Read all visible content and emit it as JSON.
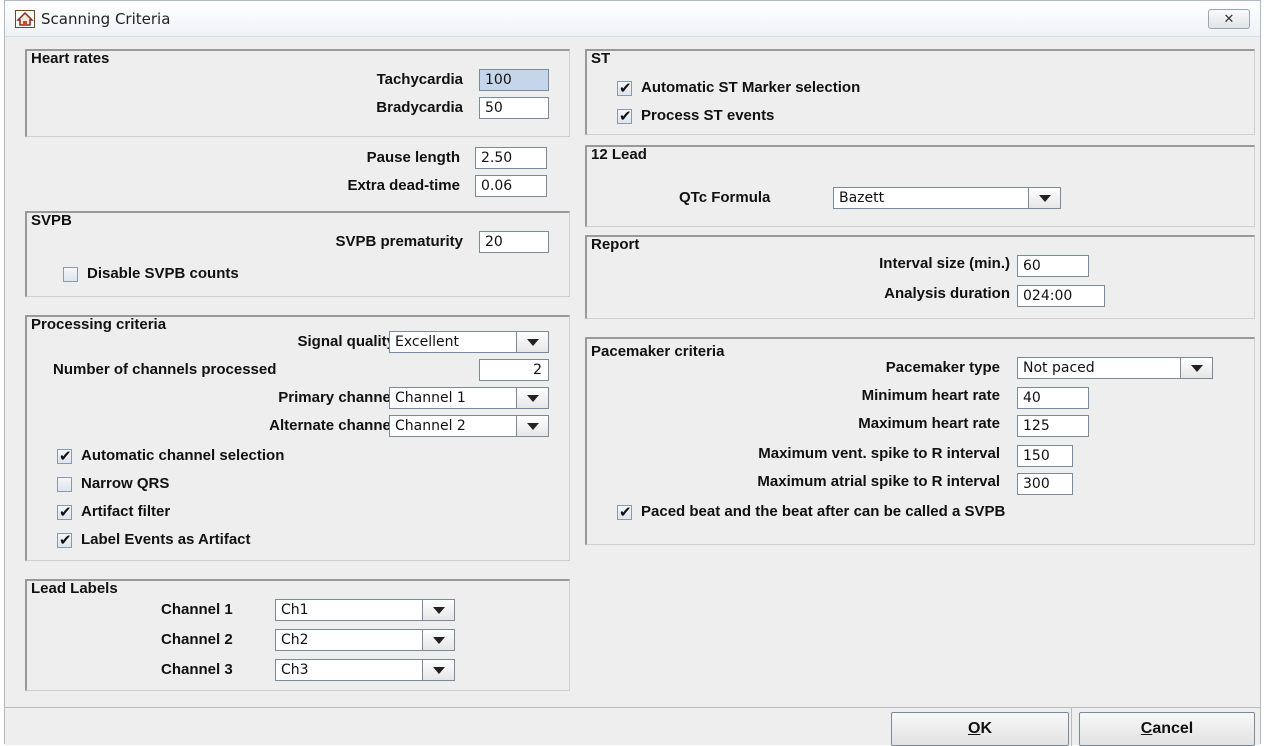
{
  "window": {
    "title": "Scanning Criteria",
    "close_glyph": "✕"
  },
  "heart_rates": {
    "title": "Heart rates",
    "tachycardia_label": "Tachycardia",
    "tachycardia_value": "100",
    "bradycardia_label": "Bradycardia",
    "bradycardia_value": "50"
  },
  "pause": {
    "pause_length_label": "Pause length",
    "pause_length_value": "2.50",
    "extra_dead_time_label": "Extra dead-time",
    "extra_dead_time_value": "0.06"
  },
  "svpb": {
    "title": "SVPB",
    "prematurity_label": "SVPB prematurity",
    "prematurity_value": "20",
    "disable_counts_label": "Disable SVPB counts",
    "disable_counts_checked": false
  },
  "processing": {
    "title": "Processing criteria",
    "signal_quality_label": "Signal quality",
    "signal_quality_value": "Excellent",
    "channels_processed_label": "Number of channels processed",
    "channels_processed_value": "2",
    "primary_channel_label": "Primary channel",
    "primary_channel_value": "Channel 1",
    "alternate_channel_label": "Alternate channel",
    "alternate_channel_value": "Channel 2",
    "auto_channel_label": "Automatic channel selection",
    "narrow_qrs_label": "Narrow QRS",
    "artifact_filter_label": "Artifact filter",
    "label_events_label": "Label Events as Artifact",
    "tick": "✔"
  },
  "lead_labels": {
    "title": "Lead Labels",
    "channel1_label": "Channel 1",
    "channel1_value": "Ch1",
    "channel2_label": "Channel 2",
    "channel2_value": "Ch2",
    "channel3_label": "Channel 3",
    "channel3_value": "Ch3"
  },
  "st": {
    "title": "ST",
    "auto_marker_label": "Automatic ST Marker selection",
    "process_events_label": "Process ST events"
  },
  "twelve_lead": {
    "title": "12 Lead",
    "qtc_label": "QTc Formula",
    "qtc_value": "Bazett"
  },
  "report": {
    "title": "Report",
    "interval_label": "Interval size (min.)",
    "interval_value": "60",
    "duration_label": "Analysis duration",
    "duration_value": "024:00"
  },
  "pacemaker": {
    "title": "Pacemaker criteria",
    "type_label": "Pacemaker type",
    "type_value": "Not paced",
    "min_hr_label": "Minimum heart rate",
    "min_hr_value": "40",
    "max_hr_label": "Maximum heart rate",
    "max_hr_value": "125",
    "vent_spike_label": "Maximum vent. spike  to R interval",
    "vent_spike_value": "150",
    "atrial_spike_label": "Maximum atrial spike to R interval",
    "atrial_spike_value": "300",
    "paced_beat_label": "Paced beat and the beat after can be called a SVPB"
  },
  "buttons": {
    "ok_mnemonic": "O",
    "ok_rest": "K",
    "cancel_mnemonic": "C",
    "cancel_rest": "ancel"
  }
}
